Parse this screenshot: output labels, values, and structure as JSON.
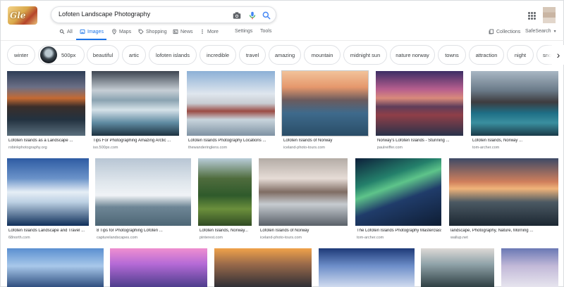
{
  "search": {
    "query": "Lofoten Landscape Photography"
  },
  "logo": {
    "text": "Gle"
  },
  "tabs": {
    "all": "All",
    "images": "Images",
    "maps": "Maps",
    "shopping": "Shopping",
    "news": "News",
    "more": "More",
    "settings": "Settings",
    "tools": "Tools",
    "collections": "Collections",
    "safesearch": "SafeSearch"
  },
  "chips": [
    "winter",
    "500px",
    "beautiful",
    "artic",
    "lofoten islands",
    "incredible",
    "travel",
    "amazing",
    "mountain",
    "midnight sun",
    "nature norway",
    "towns",
    "attraction",
    "night",
    "snow"
  ],
  "results": [
    {
      "caption": "Lofoten Islands as a Landscape ...",
      "source": "robinkphotography.org"
    },
    {
      "caption": "Tips For Photographing Amazing Arctic ...",
      "source": "iso.500px.com"
    },
    {
      "caption": "Lofoten Islands Photography Locations ...",
      "source": "thewanderinglens.com"
    },
    {
      "caption": "Lofoten Islands of Norway",
      "source": "iceland-photo-tours.com"
    },
    {
      "caption": "Norway's Lofoten Islands - Stunning ...",
      "source": "paulreiffer.com"
    },
    {
      "caption": "Lofoten Islands, Norway ...",
      "source": "tom-archer.com"
    },
    {
      "caption": "Lofoten Islands Landscape and Travel ...",
      "source": "68north.com"
    },
    {
      "caption": "8 Tips for Photographing Lofoten ...",
      "source": "capturelandscapes.com"
    },
    {
      "caption": "Lofoten Islands, Norway...",
      "source": "pinterest.com"
    },
    {
      "caption": "Lofoten Islands of Norway",
      "source": "iceland-photo-tours.com"
    },
    {
      "caption": "The Lofoten Islands Photography Masterclass ...",
      "source": "tom-archer.com"
    },
    {
      "caption": "landscape, Photography, Nature, Morning ...",
      "source": "wallup.net"
    }
  ]
}
